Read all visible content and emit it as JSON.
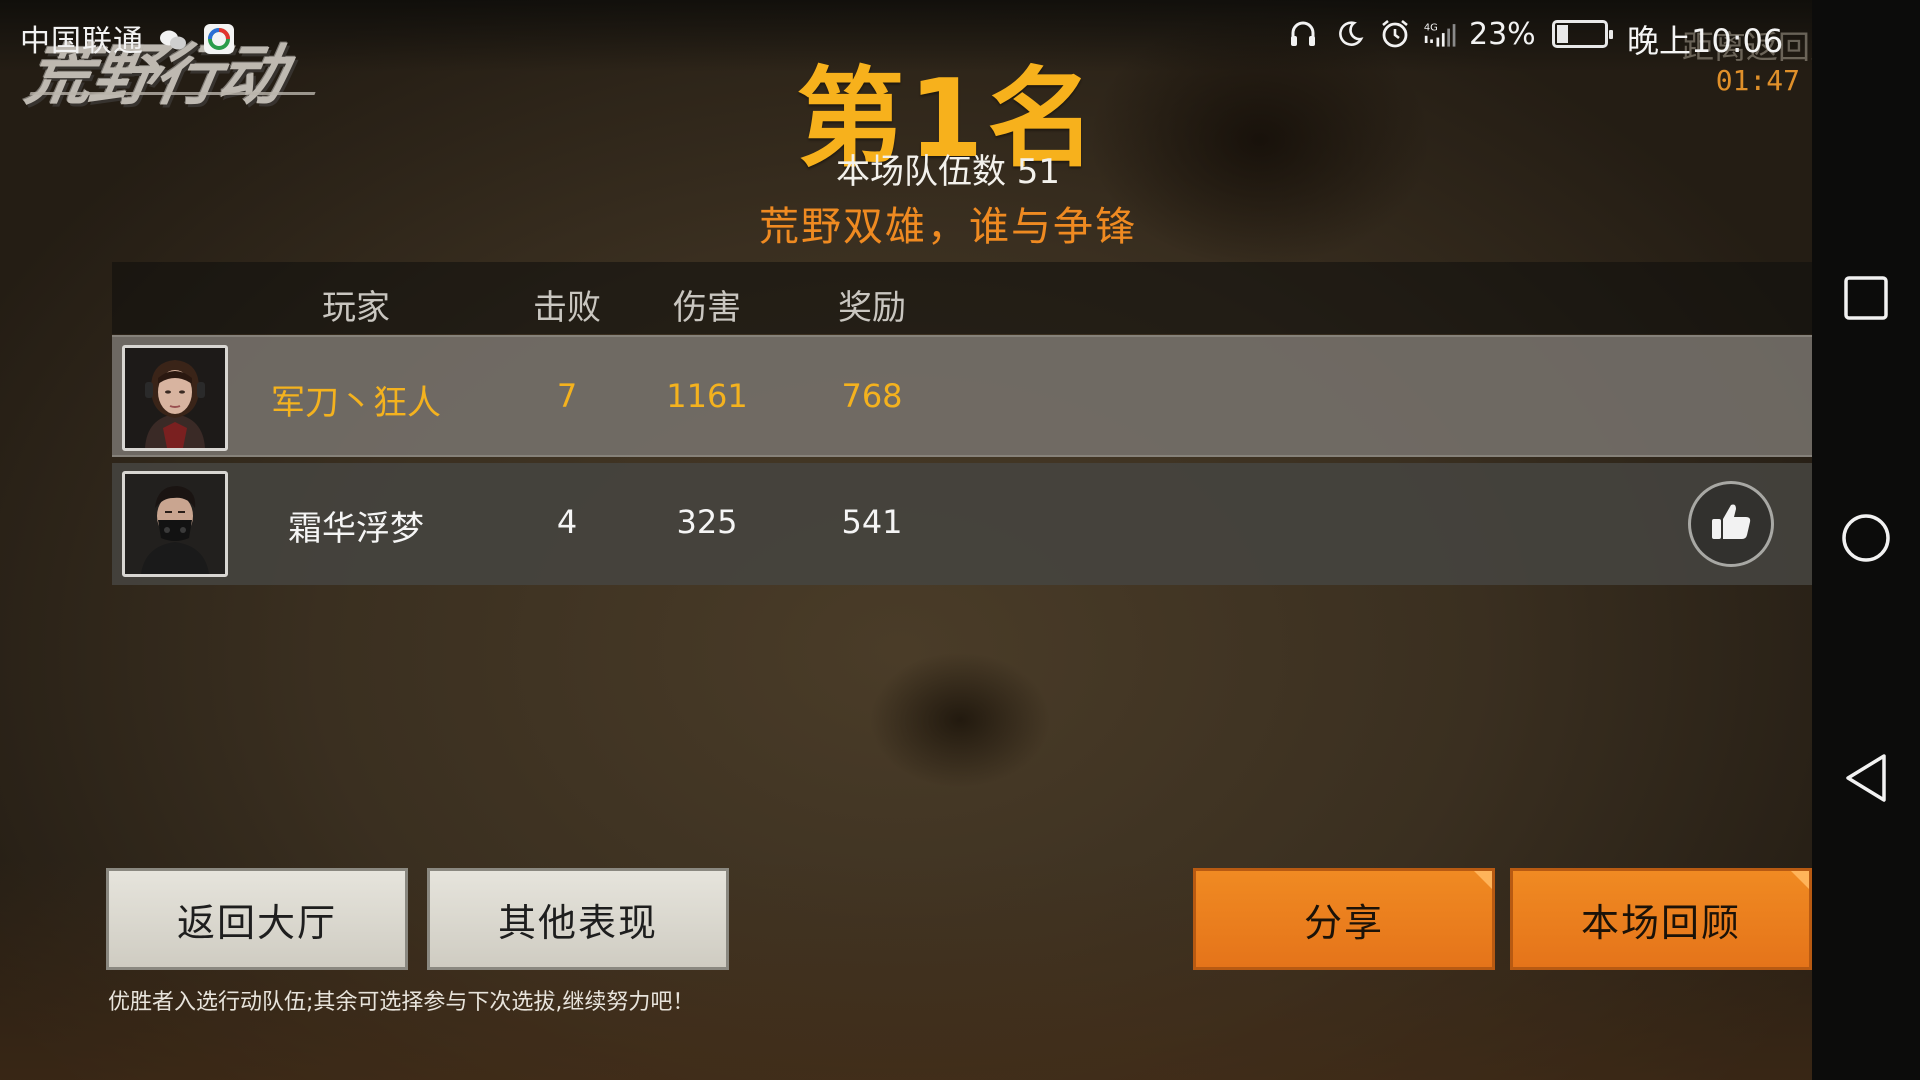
{
  "status_bar": {
    "carrier": "中国联通",
    "battery_percent": "23%",
    "time": "晚上10:06",
    "icons": [
      "wechat-icon",
      "app-icon",
      "headphones-icon",
      "moon-icon",
      "alarm-icon",
      "signal-4g-icon",
      "battery-icon"
    ]
  },
  "game": {
    "logo": "荒野行动",
    "return_hall_hint": "距离返回大厅",
    "countdown": "01:47"
  },
  "result": {
    "rank_title": "第1名",
    "team_count_label": "本场队伍数 51",
    "slogan": "荒野双雄，谁与争锋"
  },
  "table": {
    "headers": {
      "player": "玩家",
      "kills": "击败",
      "damage": "伤害",
      "reward": "奖励"
    },
    "rows": [
      {
        "name": "军刀丶狂人",
        "kills": "7",
        "damage": "1161",
        "reward": "768",
        "highlight_color": "#f4b21e"
      },
      {
        "name": "霜华浮梦",
        "kills": "4",
        "damage": "325",
        "reward": "541"
      }
    ]
  },
  "buttons": {
    "back_to_hall": "返回大厅",
    "other_performance": "其他表现",
    "share": "分享",
    "match_review": "本场回顾"
  },
  "hint": "优胜者入选行动队伍;其余可选择参与下次选拔,继续努力吧！",
  "colors": {
    "accent_gold": "#f7b11c",
    "accent_orange": "#ef8a21",
    "button_orange": "#f08a22"
  }
}
